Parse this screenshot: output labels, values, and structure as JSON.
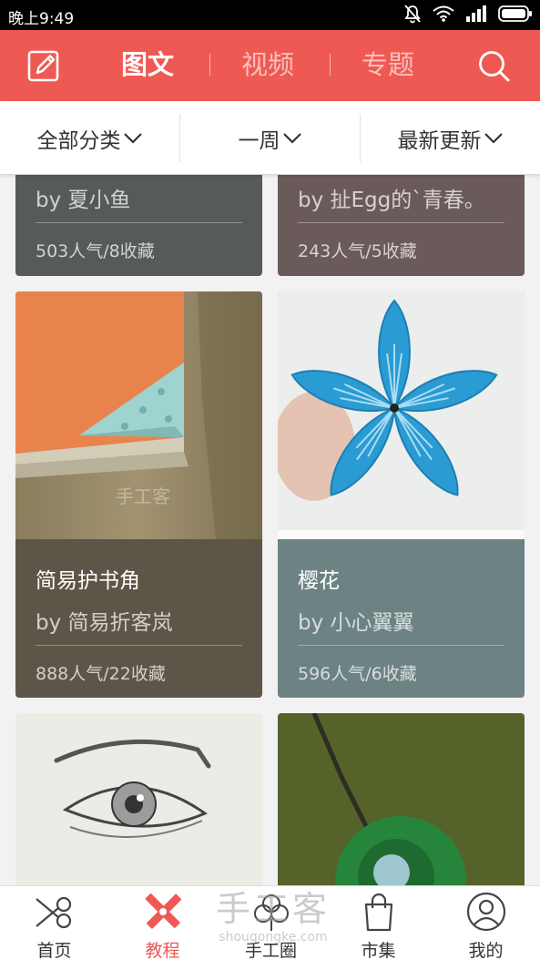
{
  "status_bar": {
    "time": "晚上9:49"
  },
  "top_bar": {
    "tabs": [
      {
        "label": "图文",
        "active": true
      },
      {
        "label": "视频",
        "active": false
      },
      {
        "label": "专题",
        "active": false
      }
    ]
  },
  "filters": [
    {
      "label": "全部分类"
    },
    {
      "label": "一周"
    },
    {
      "label": "最新更新"
    }
  ],
  "cards": [
    {
      "title": "",
      "author": "by 夏小鱼",
      "stats": "503人气/8收藏",
      "color": "#565a58"
    },
    {
      "title": "",
      "author": "by 扯Egg的`青春。",
      "stats": "243人气/5收藏",
      "color": "#6a5a59"
    },
    {
      "title": "简易护书角",
      "author": "by 简易折客岚",
      "stats": "888人气/22收藏",
      "color": "#5d5547"
    },
    {
      "title": "樱花",
      "author": "by 小心翼翼",
      "stats": "596人气/6收藏",
      "color": "#6c8283"
    }
  ],
  "image_watermark": "手工客",
  "bottom_nav": [
    {
      "label": "首页",
      "icon": "scissors-icon",
      "active": false
    },
    {
      "label": "教程",
      "icon": "pencil-ruler-icon",
      "active": true
    },
    {
      "label": "手工圈",
      "icon": "flower-icon",
      "active": false
    },
    {
      "label": "市集",
      "icon": "shopping-bag-icon",
      "active": false
    },
    {
      "label": "我的",
      "icon": "user-icon",
      "active": false
    }
  ],
  "watermark": {
    "main": "手工客",
    "sub": "shougongke.com"
  },
  "colors": {
    "accent": "#ef5953"
  }
}
